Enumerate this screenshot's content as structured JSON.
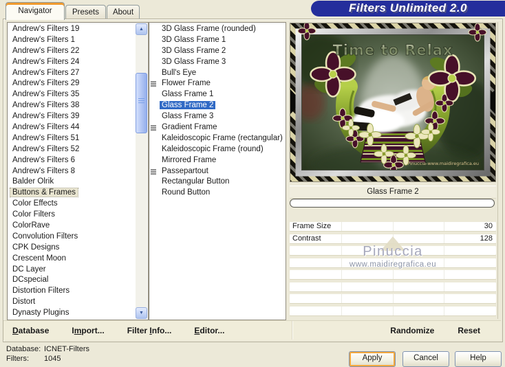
{
  "window": {
    "banner_title": "Filters Unlimited 2.0"
  },
  "tabs": {
    "items": [
      {
        "label": "Navigator"
      },
      {
        "label": "Presets"
      },
      {
        "label": "About"
      }
    ],
    "selected_index": 0
  },
  "categories": {
    "items": [
      "Andrew's Filters 19",
      "Andrew's Filters 1",
      "Andrew's Filters 22",
      "Andrew's Filters 24",
      "Andrew's Filters 27",
      "Andrew's Filters 29",
      "Andrew's Filters 35",
      "Andrew's Filters 38",
      "Andrew's Filters 39",
      "Andrew's Filters 44",
      "Andrew's Filters 51",
      "Andrew's Filters 52",
      "Andrew's Filters 6",
      "Andrew's Filters 8",
      "Balder Olrik",
      "Buttons & Frames",
      "Color Effects",
      "Color Filters",
      "ColorRave",
      "Convolution Filters",
      "CPK Designs",
      "Crescent Moon",
      "DC Layer",
      "DCspecial",
      "Distortion Filters",
      "Distort",
      "Dynasty Plugins"
    ],
    "selected_index": 15
  },
  "filters": {
    "items": [
      {
        "label": "3D Glass Frame (rounded)"
      },
      {
        "label": "3D Glass Frame 1"
      },
      {
        "label": "3D Glass Frame 2"
      },
      {
        "label": "3D Glass Frame 3"
      },
      {
        "label": "Bull's Eye"
      },
      {
        "label": "Flower Frame",
        "marker": true
      },
      {
        "label": "Glass Frame 1"
      },
      {
        "label": "Glass Frame 2"
      },
      {
        "label": "Glass Frame 3"
      },
      {
        "label": "Gradient Frame",
        "marker": true
      },
      {
        "label": "Kaleidoscopic Frame (rectangular)"
      },
      {
        "label": "Kaleidoscopic Frame (round)"
      },
      {
        "label": "Mirrored Frame"
      },
      {
        "label": "Passepartout",
        "marker": true
      },
      {
        "label": "Rectangular Button"
      },
      {
        "label": "Round Button"
      }
    ],
    "selected_index": 7
  },
  "preview": {
    "caption": "Glass Frame 2",
    "image_title": "Time to Relax",
    "image_signature": "Pinuccia-www.maidiregrafica.eu",
    "progress_value": 0
  },
  "params": {
    "rows": [
      {
        "label": "Frame Size",
        "value": "30"
      },
      {
        "label": "Contrast",
        "value": "128"
      },
      {
        "label": "",
        "value": ""
      },
      {
        "label": "",
        "value": ""
      },
      {
        "label": "",
        "value": ""
      },
      {
        "label": "",
        "value": ""
      },
      {
        "label": "",
        "value": ""
      },
      {
        "label": "",
        "value": ""
      }
    ],
    "watermark": {
      "line1": "Pinuccia",
      "line2": "www.maidiregrafica.eu"
    }
  },
  "toolbar": {
    "menu": [
      {
        "pre": "",
        "key": "D",
        "post": "atabase"
      },
      {
        "pre": "I",
        "key": "m",
        "post": "port..."
      },
      {
        "pre": "Filter ",
        "key": "I",
        "post": "nfo..."
      },
      {
        "pre": "",
        "key": "E",
        "post": "ditor..."
      }
    ],
    "actions": [
      {
        "label": "Randomize"
      },
      {
        "label": "Reset"
      }
    ]
  },
  "status": {
    "rows": [
      {
        "label": "Database:",
        "value": "ICNET-Filters"
      },
      {
        "label": "Filters:",
        "value": "1045"
      }
    ]
  },
  "dialog_buttons": {
    "apply": "Apply",
    "cancel": "Cancel",
    "help": "Help"
  },
  "colors": {
    "dialog_bg": "#ece9d8",
    "selection_blue": "#316ac5",
    "banner_navy": "#242e9c",
    "tab_accent_orange": "#f09a2e",
    "focus_ring_orange": "#f4a83d",
    "category_selection": "#e9e5d0"
  }
}
